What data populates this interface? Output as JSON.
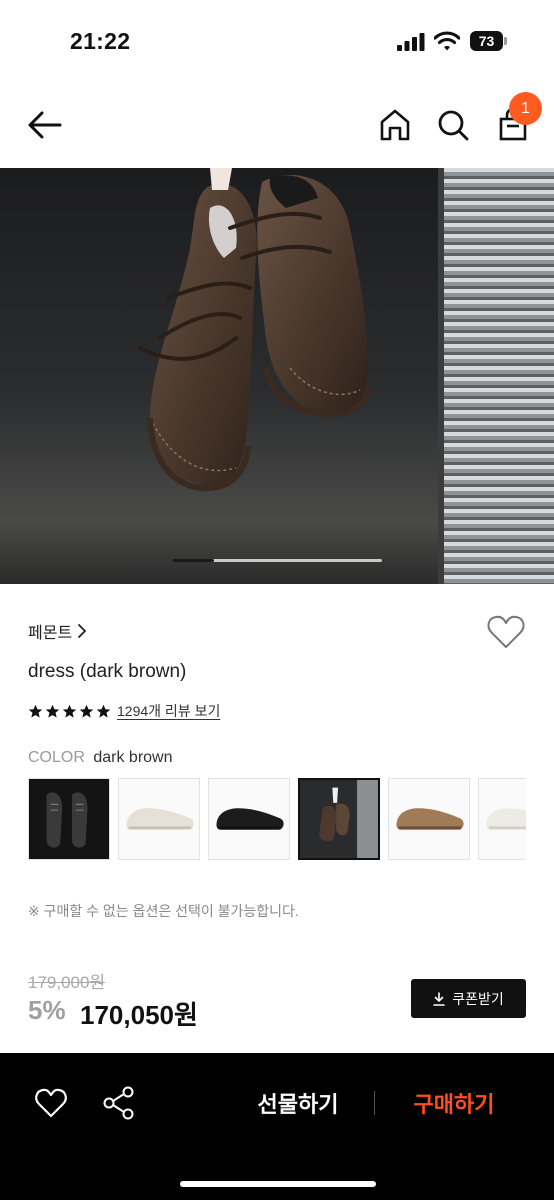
{
  "status_bar": {
    "time": "21:22",
    "battery_level": "73",
    "icons": [
      "signal-icon",
      "wifi-icon",
      "battery-icon"
    ]
  },
  "nav": {
    "icons": [
      "back-arrow-icon",
      "home-icon",
      "search-icon",
      "shopping-bag-icon"
    ],
    "cart_badge": "1"
  },
  "hero": {
    "carousel_progress": 0.2
  },
  "product": {
    "brand": "페몬트",
    "name": "dress (dark brown)",
    "rating_stars": 5,
    "review_link": "1294개 리뷰 보기",
    "color_label": "COLOR",
    "color_value": "dark brown",
    "swatches": [
      {
        "name": "black leather",
        "selected": false
      },
      {
        "name": "cream",
        "selected": false
      },
      {
        "name": "black",
        "selected": false
      },
      {
        "name": "dark brown",
        "selected": true
      },
      {
        "name": "tan suede",
        "selected": false
      },
      {
        "name": "white",
        "selected": false
      }
    ],
    "notice": "※ 구매할 수 없는 옵션은 선택이 불가능합니다.",
    "original_price": "179,000원",
    "discount_rate": "5%",
    "sale_price": "170,050원",
    "coupon_label": "쿠폰받기"
  },
  "bottom_bar": {
    "gift_label": "선물하기",
    "buy_label": "구매하기"
  },
  "colors": {
    "accent": "#ff4e1f",
    "badge": "#ff5a1f",
    "dark": "#111111"
  }
}
